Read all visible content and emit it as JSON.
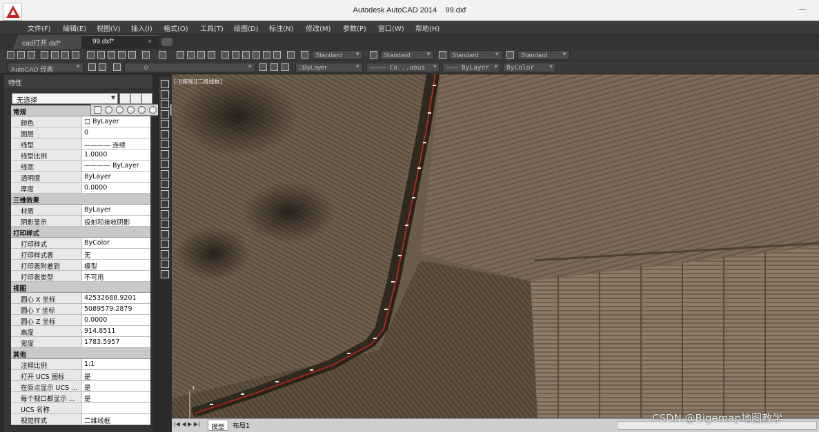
{
  "window": {
    "title": "Autodesk AutoCAD 2014",
    "file": "99.dxf"
  },
  "menu": [
    "文件(F)",
    "编辑(E)",
    "视图(V)",
    "插入(I)",
    "格式(O)",
    "工具(T)",
    "绘图(D)",
    "标注(N)",
    "修改(M)",
    "参数(P)",
    "窗口(W)",
    "帮助(H)"
  ],
  "tabs": [
    {
      "label": "cad打开.dxf*"
    },
    {
      "label": "99.dxf*",
      "close": "×"
    }
  ],
  "toolbar1": {
    "text_style": "Standard",
    "dim_style": "Standard",
    "table_style": "Standard",
    "mleader_style": "Standard"
  },
  "toolbar2": {
    "workspace": "AutoCAD 经典",
    "layer": "0",
    "color": "□ByLayer",
    "linetype": "———— Co...uous",
    "lineweight": "——— ByLayer",
    "plotstyle": "ByColor"
  },
  "palette": {
    "title": "特性",
    "selection": "无选择",
    "sections": [
      {
        "title": "常规",
        "rows": [
          [
            "颜色",
            "□ ByLayer"
          ],
          [
            "图层",
            "0"
          ],
          [
            "线型",
            "———— 连续"
          ],
          [
            "线型比例",
            "1.0000"
          ],
          [
            "线宽",
            "———— ByLayer"
          ],
          [
            "透明度",
            "ByLayer"
          ],
          [
            "厚度",
            "0.0000"
          ]
        ]
      },
      {
        "title": "三维效果",
        "rows": [
          [
            "材质",
            "ByLayer"
          ],
          [
            "阴影显示",
            "投射和接收阴影"
          ]
        ]
      },
      {
        "title": "打印样式",
        "rows": [
          [
            "打印样式",
            "ByColor"
          ],
          [
            "打印样式表",
            "无"
          ],
          [
            "打印表附着到",
            "模型"
          ],
          [
            "打印表类型",
            "不可用"
          ]
        ]
      },
      {
        "title": "视图",
        "rows": [
          [
            "圆心 X 坐标",
            "42532688.9201"
          ],
          [
            "圆心 Y 坐标",
            "5089579.2879"
          ],
          [
            "圆心 Z 坐标",
            "0.0000"
          ],
          [
            "高度",
            "914.8511"
          ],
          [
            "宽度",
            "1783.5957"
          ]
        ]
      },
      {
        "title": "其他",
        "rows": [
          [
            "注释比例",
            "1:1"
          ],
          [
            "打开 UCS 图标",
            "是"
          ],
          [
            "在原点显示 UCS ...",
            "是"
          ],
          [
            "每个视口都显示 ...",
            "是"
          ],
          [
            "UCS 名称",
            ""
          ],
          [
            "视觉样式",
            "二维线框"
          ]
        ]
      }
    ]
  },
  "viewport": {
    "label": "[-][俯视][二维线框]",
    "ucs_y": "Y"
  },
  "status": {
    "model_tab": "模型",
    "layout_tab": "布局1"
  },
  "watermark": "CSDN @Bigemap地图教学"
}
